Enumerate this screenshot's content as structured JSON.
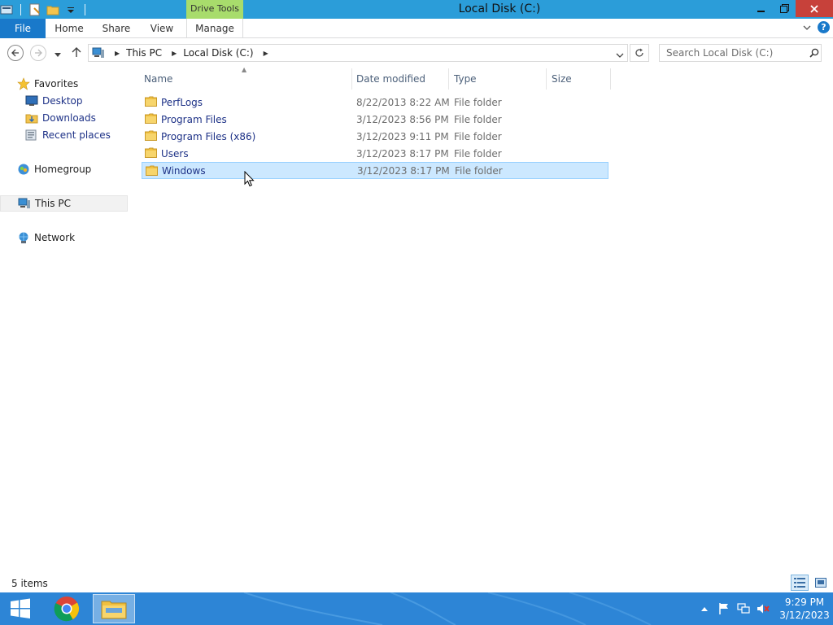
{
  "window": {
    "title": "Local Disk (C:)",
    "contextual_tab": "Drive Tools"
  },
  "ribbon": {
    "tabs": [
      {
        "label": "File"
      },
      {
        "label": "Home"
      },
      {
        "label": "Share"
      },
      {
        "label": "View"
      },
      {
        "label": "Manage"
      }
    ],
    "help_label": "?"
  },
  "address": {
    "breadcrumbs": [
      "This PC",
      "Local Disk (C:)"
    ],
    "search_placeholder": "Search Local Disk (C:)"
  },
  "nav": {
    "favorites": "Favorites",
    "favorites_items": [
      "Desktop",
      "Downloads",
      "Recent places"
    ],
    "homegroup": "Homegroup",
    "this_pc": "This PC",
    "network": "Network"
  },
  "list": {
    "columns": [
      "Name",
      "Date modified",
      "Type",
      "Size"
    ],
    "rows": [
      {
        "name": "PerfLogs",
        "date": "8/22/2013 8:22 AM",
        "type": "File folder",
        "size": ""
      },
      {
        "name": "Program Files",
        "date": "3/12/2023 8:56 PM",
        "type": "File folder",
        "size": ""
      },
      {
        "name": "Program Files (x86)",
        "date": "3/12/2023 9:11 PM",
        "type": "File folder",
        "size": ""
      },
      {
        "name": "Users",
        "date": "3/12/2023 8:17 PM",
        "type": "File folder",
        "size": ""
      },
      {
        "name": "Windows",
        "date": "3/12/2023 8:17 PM",
        "type": "File folder",
        "size": "",
        "selected": true
      }
    ]
  },
  "status": {
    "item_count": "5 items"
  },
  "taskbar": {
    "time": "9:29 PM",
    "date": "3/12/2023"
  },
  "colors": {
    "title_bar": "#2b9dd9",
    "file_tab": "#1979ca",
    "drive_tools": "#a8dc6c",
    "close_button": "#c7413a",
    "selection": "#cce8ff",
    "taskbar": "#2d85d6",
    "link_text": "#1e3287"
  },
  "icons": [
    "explorer-icon",
    "properties-icon",
    "new-folder-icon",
    "customize-qat-icon",
    "minimize-icon",
    "restore-icon",
    "close-icon",
    "back-icon",
    "forward-icon",
    "recent-locations-icon",
    "up-icon",
    "refresh-icon",
    "search-icon",
    "folder-icon",
    "star-icon",
    "desktop-icon",
    "downloads-icon",
    "recent-places-icon",
    "homegroup-icon",
    "computer-icon",
    "network-icon",
    "details-view-icon",
    "large-icons-view-icon",
    "windows-logo-icon",
    "chrome-icon",
    "file-explorer-icon",
    "show-hidden-icons-icon",
    "action-center-icon",
    "network-tray-icon",
    "volume-muted-icon"
  ]
}
